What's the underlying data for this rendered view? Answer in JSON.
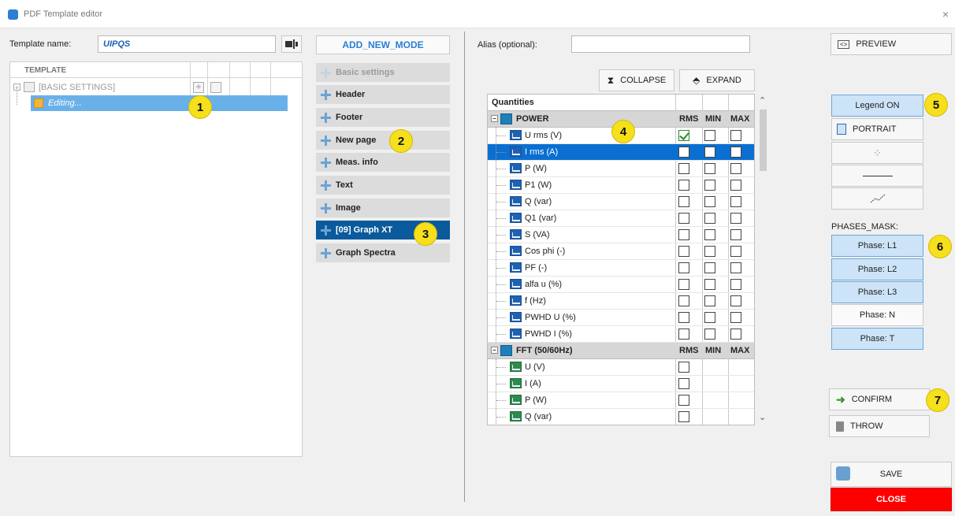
{
  "window": {
    "title": "PDF Template editor",
    "close": "×"
  },
  "left": {
    "template_name_label": "Template name:",
    "template_name_value": "UIPQS",
    "tree_header": "TEMPLATE",
    "tree_root": "[BASIC SETTINGS]",
    "tree_child": "Editing..."
  },
  "modes": {
    "add_new_mode": "ADD_NEW_MODE",
    "items": [
      "Basic settings",
      "Header",
      "Footer",
      "New page",
      "Meas. info",
      "Text",
      "Image",
      "[09] Graph XT",
      "Graph Spectra"
    ]
  },
  "center": {
    "alias_label": "Alias (optional):",
    "alias_value": "",
    "collapse": "COLLAPSE",
    "expand": "EXPAND",
    "col_quantities": "Quantities",
    "col_rms": "RMS",
    "col_min": "MIN",
    "col_max": "MAX",
    "group_power": "POWER",
    "power_rows": [
      "U rms (V)",
      "I rms (A)",
      "P (W)",
      "P1 (W)",
      "Q (var)",
      "Q1 (var)",
      "S (VA)",
      "Cos phi (-)",
      "PF (-)",
      "alfa u (%)",
      "f (Hz)",
      "PWHD U (%)",
      "PWHD I (%)"
    ],
    "group_fft": "FFT (50/60Hz)",
    "fft_rows": [
      "U (V)",
      "I (A)",
      "P (W)",
      "Q (var)"
    ]
  },
  "right": {
    "preview": "PREVIEW",
    "legend": "Legend ON",
    "portrait": "PORTRAIT",
    "phases_mask": "PHASES_MASK:",
    "phases": [
      "Phase: L1",
      "Phase: L2",
      "Phase: L3",
      "Phase: N",
      "Phase: T"
    ],
    "confirm": "CONFIRM",
    "throw": "THROW",
    "save": "SAVE",
    "close": "CLOSE"
  },
  "callouts": [
    "1",
    "2",
    "3",
    "4",
    "5",
    "6",
    "7"
  ],
  "colors": {
    "selection": "#0a6fd1",
    "active_mode": "#0a5a9c",
    "callout": "#f6df1b",
    "close": "#ff0000",
    "toggle_on": "#cde4f8"
  }
}
